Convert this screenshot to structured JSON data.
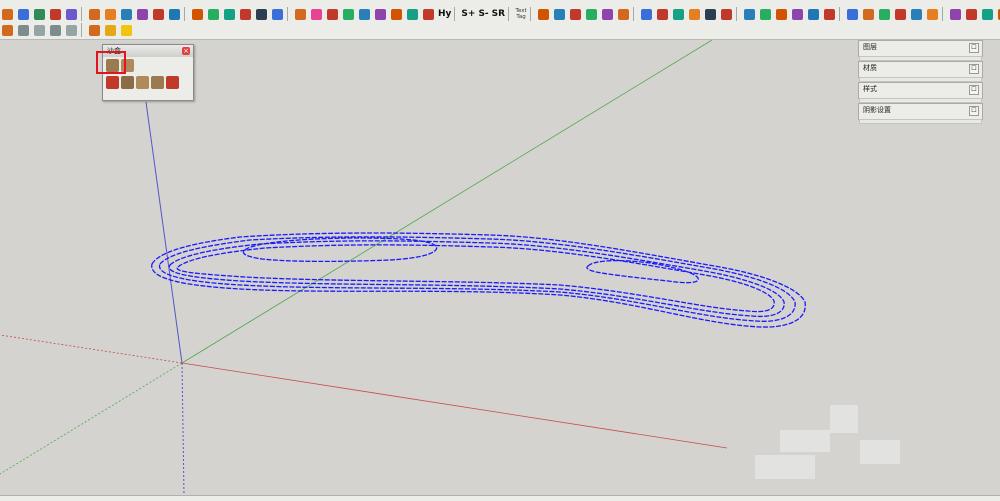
{
  "toolbar": {
    "row1": [
      "#d2691e",
      "#3a6fd8",
      "#2e8b57",
      "#c0392b",
      "#6a5acd",
      "#d2691e",
      "#e67e22",
      "#2980b9",
      "#8e44ad",
      "#c0392b",
      "#1f77b4",
      "#d35400",
      "#27ae60",
      "#16a085",
      "#c0392b",
      "#2c3e50",
      "#3a6fd8",
      "#d2691e",
      "#e84393",
      "#c0392b",
      "#27ae60",
      "#2980b9",
      "#8e44ad",
      "#d35400",
      "#16a085",
      "#c0392b"
    ],
    "row1b": [
      "#d35400",
      "#2980b9",
      "#c0392b",
      "#27ae60",
      "#8e44ad",
      "#d2691e",
      "#3a6fd8",
      "#c0392b",
      "#16a085",
      "#e67e22",
      "#2c3e50",
      "#c0392b",
      "#2980b9",
      "#27ae60",
      "#d35400",
      "#8e44ad",
      "#1f77b4",
      "#c0392b",
      "#3a6fd8",
      "#d2691e",
      "#27ae60",
      "#c0392b",
      "#2980b9",
      "#e67e22",
      "#8e44ad",
      "#c0392b",
      "#16a085",
      "#d35400",
      "#2980b9",
      "#c0392b",
      "#27ae60",
      "#d2691e"
    ],
    "labels": {
      "hy": "Hy",
      "s_plus": "S+",
      "s_minus": "S-",
      "s_r": "SR",
      "text_tag": "Text Tag"
    },
    "row2": [
      "#d2691e",
      "#7f8c8d",
      "#95a5a6",
      "#7f8c8d",
      "#95a5a6",
      "#d2691e",
      "#e6a817",
      "#f1c40f"
    ]
  },
  "sandbox": {
    "title": "沙盒",
    "row1_icons": [
      "#9c7a4f",
      "#b08a5a"
    ],
    "row2_icons": [
      "#c0392b",
      "#8e6b47",
      "#b08a5a",
      "#9c7a4f",
      "#c0392b"
    ]
  },
  "tray": {
    "items": [
      {
        "label": "图层",
        "close": "☐"
      },
      {
        "label": "材质",
        "close": "☐"
      },
      {
        "label": "样式",
        "close": "☐"
      },
      {
        "label": "阴影设置",
        "close": "☐"
      }
    ]
  },
  "colors": {
    "contour": "#1a1aff",
    "axis_blue": "#5656c8",
    "axis_green": "#4fa84f",
    "axis_red": "#c84a4a"
  }
}
